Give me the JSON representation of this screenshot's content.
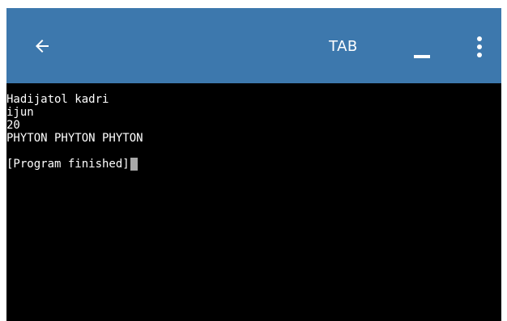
{
  "toolbar": {
    "back_icon": "arrow-left-icon",
    "tab_label": "TAB",
    "minimize_icon": "minimize-icon",
    "more_icon": "more-vertical-icon",
    "background_color": "#3d78ad"
  },
  "terminal": {
    "background_color": "#000000",
    "text_color": "#ffffff",
    "lines": [
      "Hadijatol kadri",
      "ijun",
      "20",
      "PHYTON PHYTON PHYTON",
      "",
      "[Program finished]"
    ],
    "cursor_visible": true
  }
}
